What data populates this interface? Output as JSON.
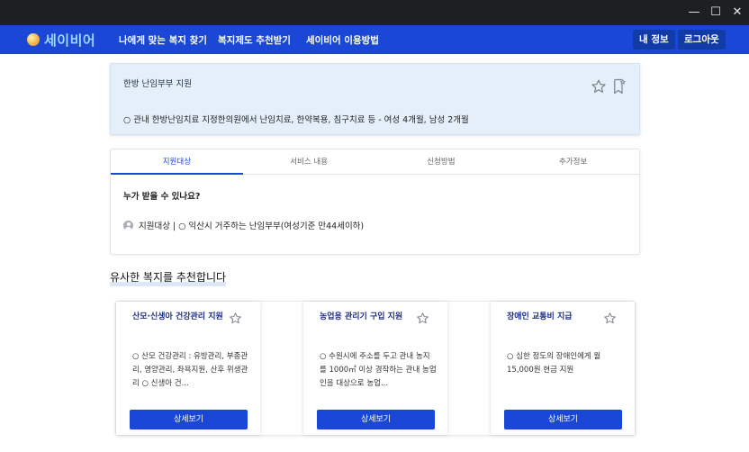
{
  "window": {
    "minimize_glyph": "—",
    "maximize_glyph": "☐",
    "close_glyph": "✕"
  },
  "nav": {
    "logo_text": "세이비어",
    "links": [
      "나에게 맞는 복지 찾기",
      "복지제도 추천받기",
      "세이비어 이용방법"
    ],
    "my_info": "내 정보",
    "logout": "로그아웃"
  },
  "colors": {
    "brand_blue": "#1a47d6",
    "hero_bg": "#e4effa",
    "titlebar": "#1e1f22"
  },
  "hero": {
    "title": "한방 난임부부 지원",
    "description": "○ 관내 한방난임치료 지정한의원에서 난임치료, 한약복용, 침구치료 등 - 여성 4개월, 남성 2개월",
    "icons": [
      "star-outline-icon",
      "bookmark-outline-icon"
    ]
  },
  "tabs": [
    "지원대상",
    "서비스 내용",
    "신청방법",
    "추가정보"
  ],
  "support": {
    "question": "누가 받을 수 있나요?",
    "target_text": "지원대상 | ○ 익산시 거주하는 난임부부(여성기준 만44세이하)"
  },
  "recommend": {
    "section_title": "유사한 복지를 추천합니다",
    "cards": [
      {
        "title": "산모·신생아 건강관리 지원",
        "desc": "○ 산모 건강관리 : 유방관리, 부종관리, 영양관리, 좌욕지원, 산후 위생관리 ○ 신생아 건...",
        "button": "상세보기"
      },
      {
        "title": "농업용 관리기 구입 지원",
        "desc": "○ 수원시에 주소를 두고 관내 농지를 1000㎡ 이상 경작하는 관내 농업인을 대상으로 농업...",
        "button": "상세보기"
      },
      {
        "title": "장애인 교통비 지급",
        "desc": "○ 심한 정도의 장애인에게 월 15,000원 현금 지원",
        "button": "상세보기"
      }
    ]
  }
}
